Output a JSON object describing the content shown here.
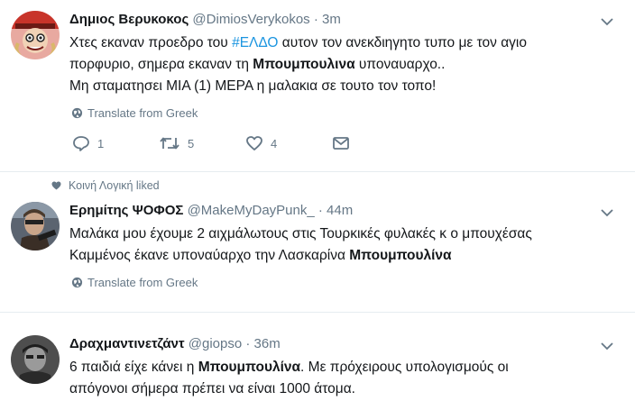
{
  "tweet1": {
    "name": "Δημιος Βερυκοκος",
    "handle": "@DimiosVerykokos",
    "dot": "·",
    "time": "3m",
    "line1_pre": "Χτες εκαναν προεδρο του ",
    "hashtag": "#ΕΛΔΟ",
    "line1_post": " αυτον τον ανεκδιηγητο τυπο με τον αγιο",
    "line2_pre": "πορφυριο, σημερα εκαναν τη ",
    "line2_bold": "Μπουμπουλινα",
    "line2_post": " υποναυαρχο..",
    "line3": "Μη σταματησει ΜΙΑ (1) ΜΕΡΑ η μαλακια σε τουτο τον τοπο!",
    "translate": "Translate from Greek",
    "replies": "1",
    "retweets": "5",
    "likes": "4"
  },
  "liked_context": "Κοινή Λογική liked",
  "tweet2": {
    "name": "Ερημίτης ΨΟΦΟΣ",
    "handle": "@MakeMyDayPunk_",
    "dot": "·",
    "time": "44m",
    "line1": "Μαλάκα μου έχουμε 2 αιχμάλωτους στις Τουρκικές φυλακές κ ο μπουχέσας",
    "line2_pre": "Καμμένος έκανε υποναύαρχο την Λασκαρίνα ",
    "line2_bold": "Μπουμπουλίνα",
    "translate": "Translate from Greek"
  },
  "tweet3": {
    "name": "Δραχμαντινετζάντ",
    "handle": "@giopso",
    "dot": "·",
    "time": "36m",
    "line1_pre": "6 παιδιά είχε κάνει η ",
    "line1_bold": "Μπουμπουλίνα",
    "line1_post": ". Με πρόχειρους υπολογισμούς οι",
    "line2": "απόγονοι σήμερα πρέπει να είναι 1000 άτομα."
  },
  "colors": {
    "accent": "#1b95e0",
    "text": "#14171a",
    "secondary": "#657786",
    "divider": "#e6ecf0"
  },
  "icons": [
    "globe-icon",
    "reply-icon",
    "retweet-icon",
    "like-icon",
    "message-icon",
    "chevron-down-icon",
    "heart-icon"
  ]
}
